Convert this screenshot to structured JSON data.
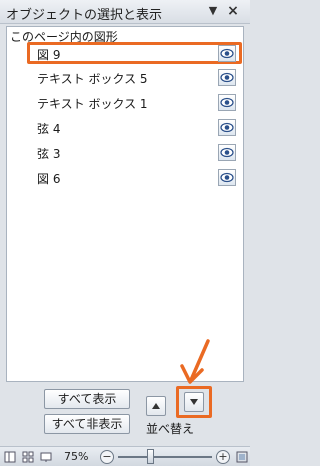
{
  "pane": {
    "title": "オブジェクトの選択と表示",
    "dropdown_icon": "dropdown-triangle-icon",
    "close_icon": "close-x-icon"
  },
  "section": {
    "title": "このページ内の図形"
  },
  "items": [
    {
      "label": "図 9",
      "selected": true,
      "visible": true
    },
    {
      "label": "テキスト ボックス 5",
      "selected": false,
      "visible": true
    },
    {
      "label": "テキスト ボックス 1",
      "selected": false,
      "visible": true
    },
    {
      "label": "弦 4",
      "selected": false,
      "visible": true
    },
    {
      "label": "弦 3",
      "selected": false,
      "visible": true
    },
    {
      "label": "図 6",
      "selected": false,
      "visible": true
    }
  ],
  "buttons": {
    "show_all": "すべて表示",
    "hide_all": "すべて非表示",
    "reorder": "並べ替え"
  },
  "status_bar": {
    "zoom": "75%",
    "zoom_out": "−",
    "zoom_in": "+",
    "zoom_fraction": 0.35
  },
  "colors": {
    "highlight": "#ea6a23",
    "eye": "#2a4f8a"
  }
}
